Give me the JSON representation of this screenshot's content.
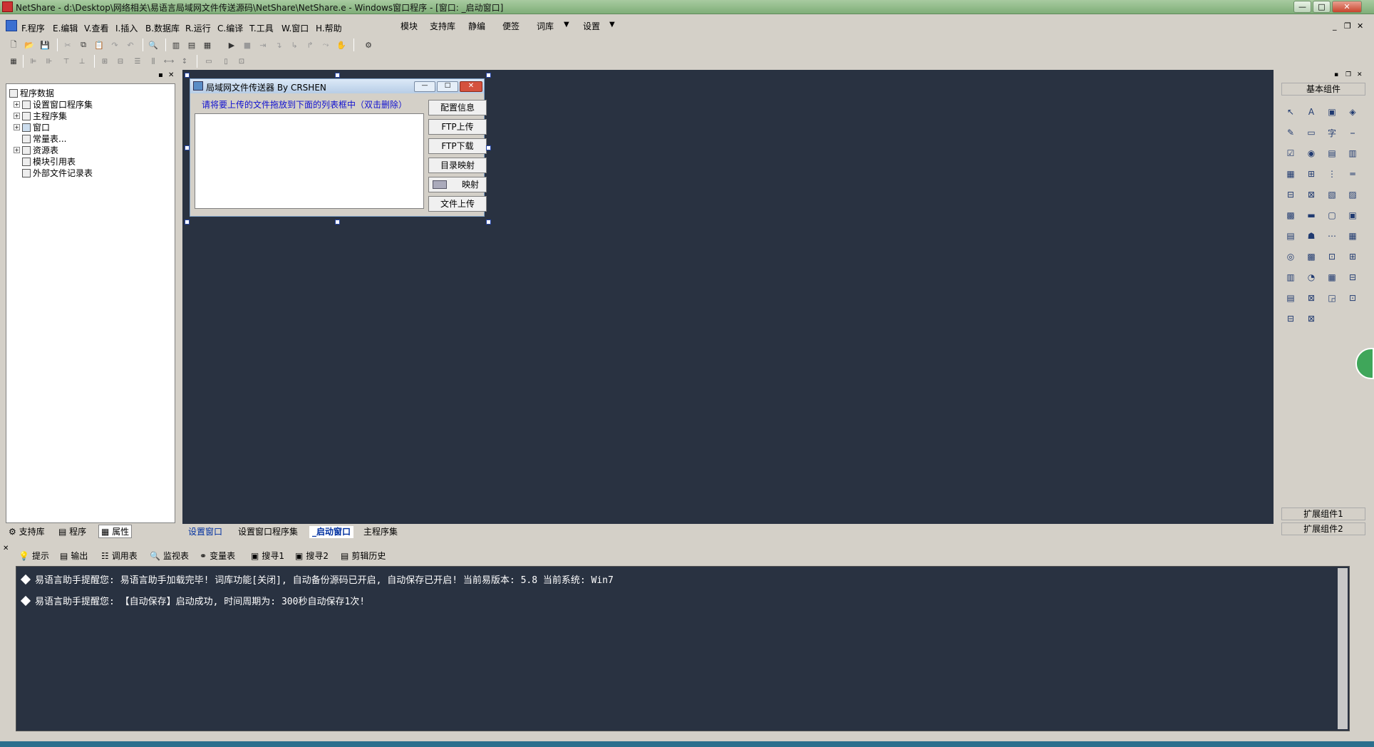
{
  "window": {
    "title": "NetShare - d:\\Desktop\\网络相关\\易语言局域网文件传送源码\\NetShare\\NetShare.e - Windows窗口程序 - [窗口: _启动窗口]",
    "min": "—",
    "max": "□",
    "close": "✕"
  },
  "menu": {
    "items": [
      "F.程序",
      "E.编辑",
      "V.查看",
      "I.插入",
      "B.数据库",
      "R.运行",
      "C.编译",
      "T.工具",
      "W.窗口",
      "H.帮助"
    ],
    "extras": [
      "模块",
      "支持库",
      "静编",
      "便签",
      "词库",
      "设置"
    ]
  },
  "left": {
    "tree": [
      {
        "label": "程序数据",
        "indent": 0,
        "expand": false
      },
      {
        "label": "设置窗口程序集",
        "indent": 1,
        "expand": true
      },
      {
        "label": "主程序集",
        "indent": 1,
        "expand": true
      },
      {
        "label": "窗口",
        "indent": 1,
        "expand": true
      },
      {
        "label": "常量表...",
        "indent": 1,
        "expand": false
      },
      {
        "label": "资源表",
        "indent": 1,
        "expand": true
      },
      {
        "label": "模块引用表",
        "indent": 1,
        "expand": false
      },
      {
        "label": "外部文件记录表",
        "indent": 1,
        "expand": false
      }
    ],
    "tabs": [
      "支持库",
      "程序",
      "属性"
    ]
  },
  "design": {
    "title": "局域网文件传送器 By CRSHEN",
    "hint": "请将要上传的文件拖放到下面的列表框中（双击删除）",
    "buttons": [
      "配置信息",
      "FTP上传",
      "FTP下载",
      "目录映射",
      "映射",
      "文件上传"
    ]
  },
  "doc_tabs": [
    "设置窗口",
    "设置窗口程序集",
    "_启动窗口",
    "主程序集"
  ],
  "right": {
    "header": "基本组件",
    "ext1": "扩展组件1",
    "ext2": "扩展组件2",
    "components": [
      "↖",
      "A",
      "▣",
      "◈",
      "✎",
      "▭",
      "字",
      "⎯",
      "☑",
      "◉",
      "▤",
      "▥",
      "▦",
      "⊞",
      "⋮",
      "═",
      "⊟",
      "⊠",
      "▧",
      "▨",
      "▩",
      "▬",
      "▢",
      "▣",
      "▤",
      "☗",
      "⋯",
      "▦",
      "◎",
      "▩",
      "⊡",
      "⊞",
      "▥",
      "◔",
      "▦",
      "⊟",
      "▤",
      "⊠",
      "◲",
      "⊡",
      "⊟",
      "⊠"
    ]
  },
  "output_tabs": [
    "提示",
    "输出",
    "调用表",
    "监视表",
    "变量表",
    "搜寻1",
    "搜寻2",
    "剪辑历史"
  ],
  "output_lines": [
    "易语言助手提醒您:  易语言助手加载完毕!  词库功能[关闭], 自动备份源码已开启, 自动保存已开启!  当前易版本: 5.8  当前系统: Win7",
    "易语言助手提醒您: 【自动保存】启动成功, 时间周期为: 300秒自动保存1次!"
  ]
}
